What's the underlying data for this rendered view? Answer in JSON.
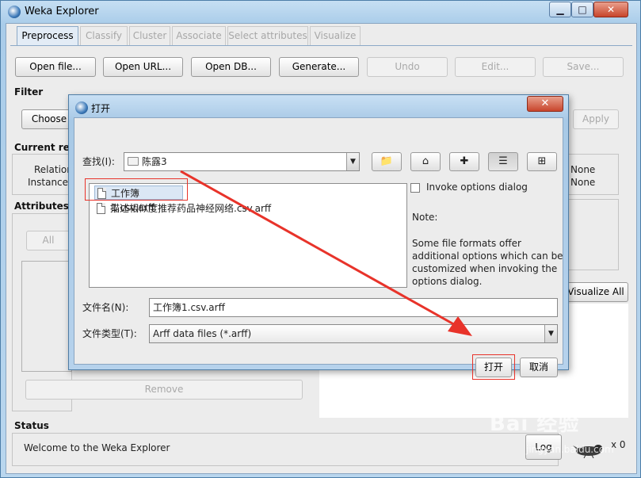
{
  "window": {
    "title": "Weka Explorer",
    "minimize": "▁",
    "maximize": "□",
    "close": "✕"
  },
  "tabs": [
    "Preprocess",
    "Classify",
    "Cluster",
    "Associate",
    "Select attributes",
    "Visualize"
  ],
  "toolbar": {
    "open_file": "Open file...",
    "open_url": "Open URL...",
    "open_db": "Open DB...",
    "generate": "Generate...",
    "undo": "Undo",
    "edit": "Edit...",
    "save": "Save..."
  },
  "filter": {
    "label": "Filter",
    "choose": "Choose",
    "apply": "Apply"
  },
  "current_relation": {
    "label": "Current rela",
    "relation_label": "Relation",
    "instances_label": "Instances",
    "right_value1": "None",
    "right_value2": "None"
  },
  "attributes": {
    "label": "Attributes",
    "all_button": "All",
    "remove_button": "Remove"
  },
  "visualize_all": "Visualize All",
  "status": {
    "label": "Status",
    "message": "Welcome to the Weka Explorer",
    "log_button": "Log",
    "count": "x 0"
  },
  "dialog": {
    "title": "打开",
    "close": "✕",
    "look_in_label": "查找(I):",
    "look_in_value": "陈露3",
    "files": [
      {
        "name": "工作簿1.csv.arff",
        "selected": true
      },
      {
        "name": "描述相似度推荐药品神经网络.csv.arff",
        "selected": false
      }
    ],
    "invoke_options_label": "Invoke options dialog",
    "invoke_options_checked": false,
    "note_title": "Note:",
    "note_text": "Some file formats offer additional options which can be customized when invoking the options dialog.",
    "filename_label": "文件名(N):",
    "filename_value": "工作簿1.csv.arff",
    "filetype_label": "文件类型(T):",
    "filetype_value": "Arff data files (*.arff)",
    "open_button": "打开",
    "cancel_button": "取消"
  },
  "watermark": {
    "brand": "Bai 经验",
    "url": "jingyan.baidu.com"
  },
  "colors": {
    "annotation_red": "#e8332a",
    "title_bar": "#a9cce9"
  }
}
